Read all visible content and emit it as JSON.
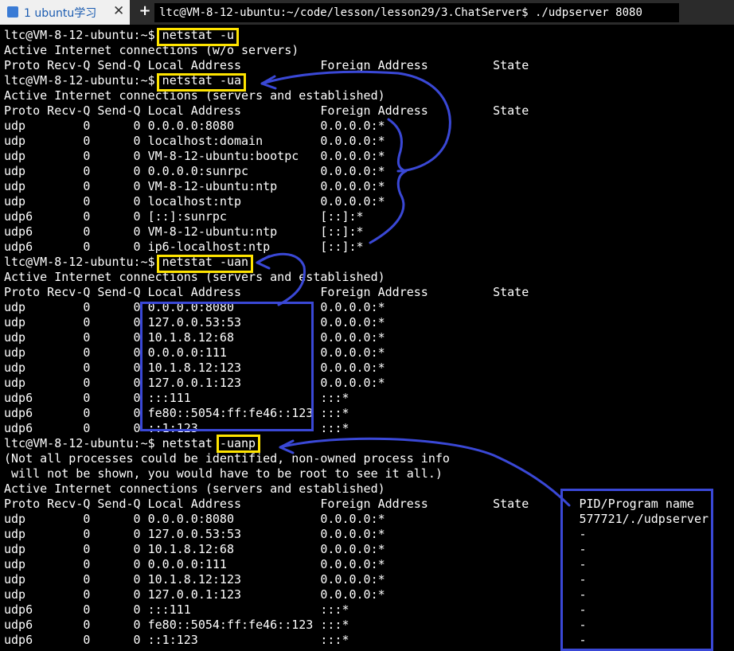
{
  "tab": {
    "label": "1 ubuntu学习",
    "close": "✕",
    "new": "+"
  },
  "window_title": "ltc@VM-8-12-ubuntu:~/code/lesson/lesson29/3.ChatServer$ ./udpserver 8080",
  "lines": [
    "ltc@VM-8-12-ubuntu:~$ netstat -u",
    "Active Internet connections (w/o servers)",
    "Proto Recv-Q Send-Q Local Address           Foreign Address         State",
    "ltc@VM-8-12-ubuntu:~$ netstat -ua",
    "Active Internet connections (servers and established)",
    "Proto Recv-Q Send-Q Local Address           Foreign Address         State",
    "udp        0      0 0.0.0.0:8080            0.0.0.0:*",
    "udp        0      0 localhost:domain        0.0.0.0:*",
    "udp        0      0 VM-8-12-ubuntu:bootpc   0.0.0.0:*",
    "udp        0      0 0.0.0.0:sunrpc          0.0.0.0:*",
    "udp        0      0 VM-8-12-ubuntu:ntp      0.0.0.0:*",
    "udp        0      0 localhost:ntp           0.0.0.0:*",
    "udp6       0      0 [::]:sunrpc             [::]:*",
    "udp6       0      0 VM-8-12-ubuntu:ntp      [::]:*",
    "udp6       0      0 ip6-localhost:ntp       [::]:*",
    "ltc@VM-8-12-ubuntu:~$ netstat -uan",
    "Active Internet connections (servers and established)",
    "Proto Recv-Q Send-Q Local Address           Foreign Address         State",
    "udp        0      0 0.0.0.0:8080            0.0.0.0:*",
    "udp        0      0 127.0.0.53:53           0.0.0.0:*",
    "udp        0      0 10.1.8.12:68            0.0.0.0:*",
    "udp        0      0 0.0.0.0:111             0.0.0.0:*",
    "udp        0      0 10.1.8.12:123           0.0.0.0:*",
    "udp        0      0 127.0.0.1:123           0.0.0.0:*",
    "udp6       0      0 :::111                  :::*",
    "udp6       0      0 fe80::5054:ff:fe46::123 :::*",
    "udp6       0      0 ::1:123                 :::*",
    "ltc@VM-8-12-ubuntu:~$ netstat -uanp",
    "(Not all processes could be identified, non-owned process info",
    " will not be shown, you would have to be root to see it all.)",
    "Active Internet connections (servers and established)",
    "Proto Recv-Q Send-Q Local Address           Foreign Address         State       PID/Program name",
    "udp        0      0 0.0.0.0:8080            0.0.0.0:*                           577721/./udpserver",
    "udp        0      0 127.0.0.53:53           0.0.0.0:*                           -",
    "udp        0      0 10.1.8.12:68            0.0.0.0:*                           -",
    "udp        0      0 0.0.0.0:111             0.0.0.0:*                           -",
    "udp        0      0 10.1.8.12:123           0.0.0.0:*                           -",
    "udp        0      0 127.0.0.1:123           0.0.0.0:*                           -",
    "udp6       0      0 :::111                  :::*                                -",
    "udp6       0      0 fe80::5054:ff:fe46::123 :::*                                -",
    "udp6       0      0 ::1:123                 :::*                                -"
  ],
  "colors": {
    "highlight": "#ffe400",
    "annotation": "#3a48d6",
    "background": "#000000",
    "text": "#ffffff"
  }
}
